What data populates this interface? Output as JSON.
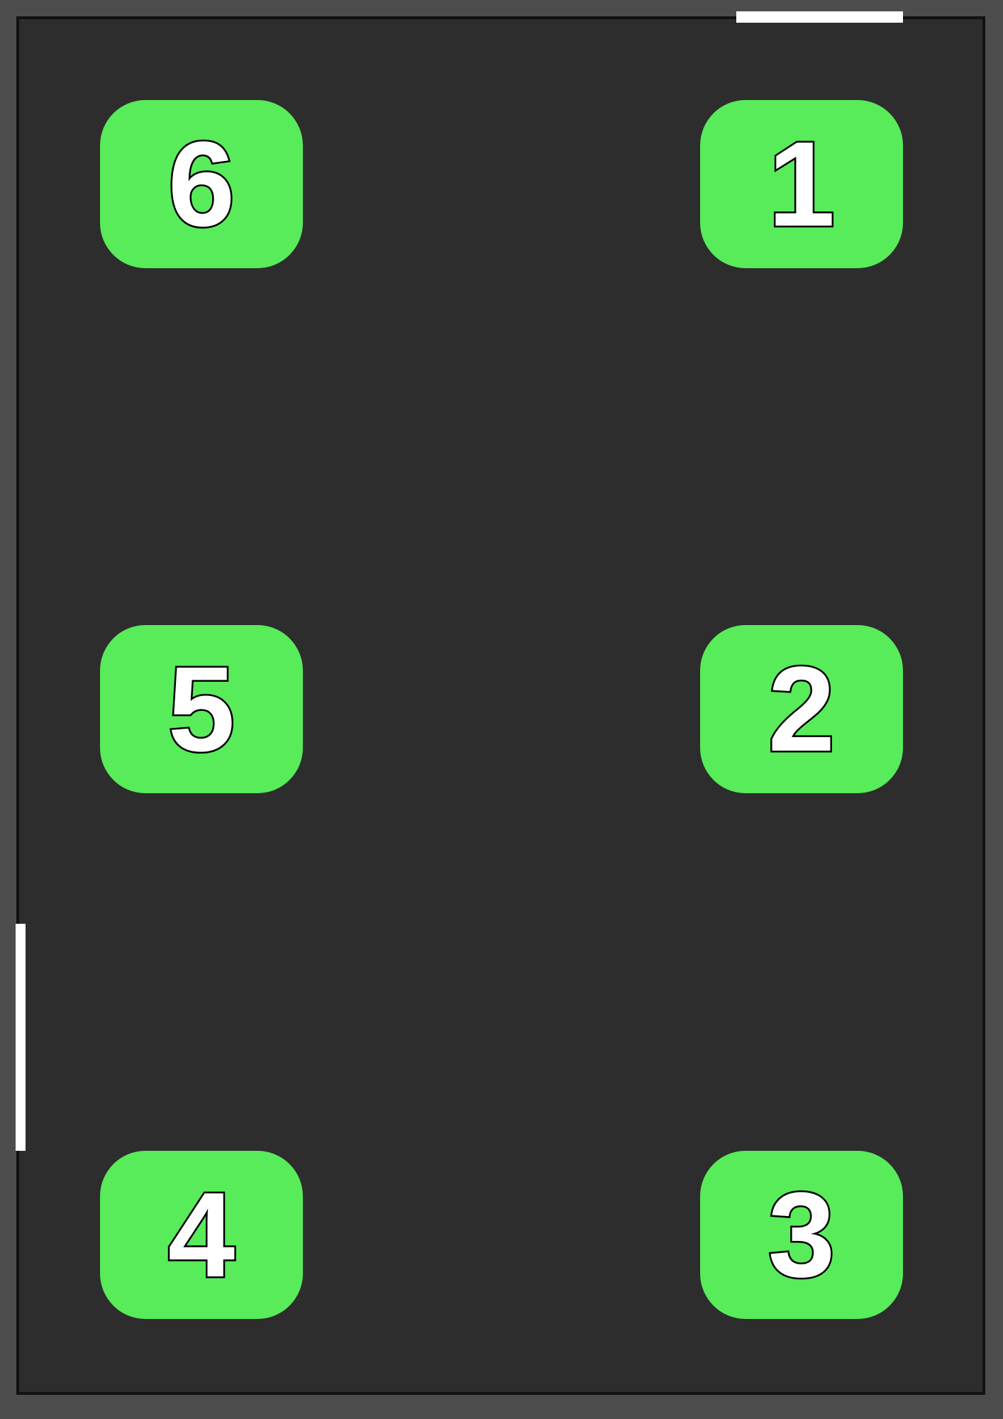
{
  "colors": {
    "background": "#4d4d4d",
    "floor": "#2d2d2d",
    "wall": "#111111",
    "door": "#ffffff",
    "station_fill": "#58eb5a",
    "label_fill": "#ffffff",
    "label_stroke": "#000000"
  },
  "stations": {
    "s1": {
      "label": "1"
    },
    "s2": {
      "label": "2"
    },
    "s3": {
      "label": "3"
    },
    "s4": {
      "label": "4"
    },
    "s5": {
      "label": "5"
    },
    "s6": {
      "label": "6"
    }
  }
}
